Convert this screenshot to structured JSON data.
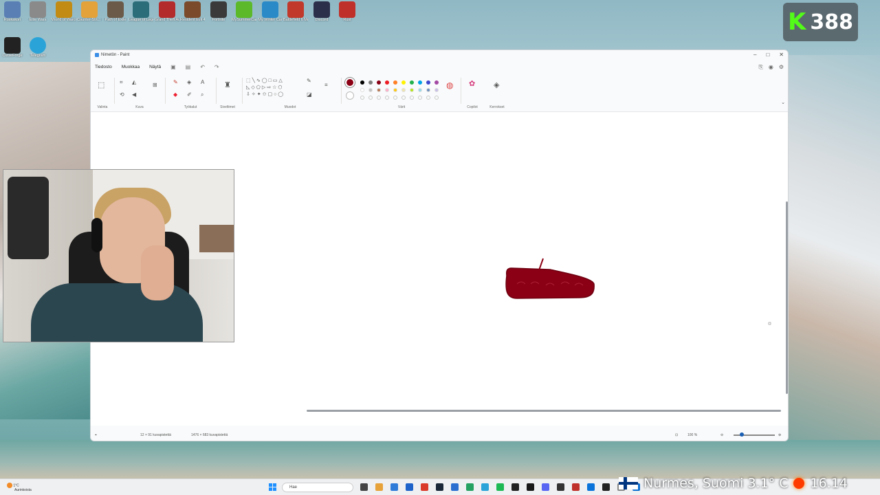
{
  "desktop": {
    "icons": [
      {
        "label": "Roskakori",
        "color": "#5a7fb5"
      },
      {
        "label": "Elite Wars",
        "color": "#8a8a8a"
      },
      {
        "label": "World of Warcraft",
        "color": "#c28b14"
      },
      {
        "label": "Counter-Stri... 2",
        "color": "#e3a23a"
      },
      {
        "label": "Path of Exile",
        "color": "#6b5a48"
      },
      {
        "label": "League of Legends",
        "color": "#2b6e7a"
      },
      {
        "label": "Grand Theft Auto V",
        "color": "#b32b2b"
      },
      {
        "label": "Resident Evil 4 Remake",
        "color": "#7a4a2a"
      },
      {
        "label": "Fortnite",
        "color": "#3a3a3a"
      },
      {
        "label": "MySummerCar",
        "color": "#5cba2a"
      },
      {
        "label": "My Winter Car",
        "color": "#2a8ac8"
      },
      {
        "label": "Battlefield 6 Multiplayer",
        "color": "#c0392b"
      },
      {
        "label": "Discord",
        "color": "#2c2f4a"
      },
      {
        "label": "Rust",
        "color": "#c0302a"
      },
      {
        "label": "CurseForge",
        "color": "#222222"
      },
      {
        "label": "Telegram",
        "color": "#2aa3d8"
      }
    ]
  },
  "kick": {
    "letter": "K",
    "viewer_count": "388"
  },
  "window": {
    "title": "Nimetön - Paint",
    "menu": [
      "Tiedosto",
      "Muokkaa",
      "Näytä"
    ],
    "groups": {
      "selection": "Valinta",
      "image": "Kuva",
      "tools": "Työkalut",
      "brushes": "Siveltimet",
      "shapes": "Muodot",
      "colors": "Värit",
      "copilot": "Copilot",
      "layers": "Kerrokset"
    },
    "palette_row1": [
      "#000000",
      "#7f7f7f",
      "#880015",
      "#ed1c24",
      "#ff7f27",
      "#fff200",
      "#22b14c",
      "#00a2e8",
      "#3f48cc",
      "#a349a4"
    ],
    "palette_row2": [
      "#ffffff",
      "#c3c3c3",
      "#b97a57",
      "#ffaec9",
      "#ffc90e",
      "#efe4b0",
      "#b5e61d",
      "#99d9ea",
      "#7092be",
      "#c8bfe7"
    ],
    "primary_color": "#8b0014",
    "status": {
      "cursor": "12 × 91 kuvapistettä",
      "canvas_size": "1476 × 683 kuvapistettä",
      "zoom": "100 %"
    }
  },
  "taskbar": {
    "weather_temp": "1°C",
    "weather_desc": "Aurinkoista",
    "search_placeholder": "Hae",
    "location_overlay": "Nurmes, Suomi  3.1° C",
    "time": "16.14"
  }
}
